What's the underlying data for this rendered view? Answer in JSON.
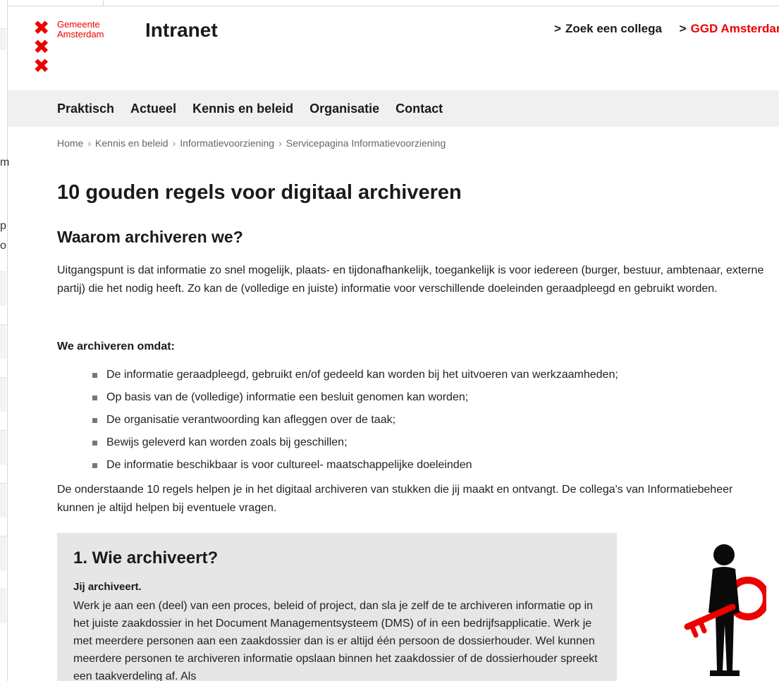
{
  "header": {
    "logo_line1": "Gemeente",
    "logo_line2": "Amsterdam",
    "site_title": "Intranet",
    "top_links": [
      {
        "label": "Zoek een collega"
      },
      {
        "label": "GGD Amsterdam"
      }
    ]
  },
  "nav": {
    "items": [
      {
        "label": "Praktisch"
      },
      {
        "label": "Actueel"
      },
      {
        "label": "Kennis en beleid"
      },
      {
        "label": "Organisatie"
      },
      {
        "label": "Contact"
      }
    ]
  },
  "breadcrumb": [
    "Home",
    "Kennis en beleid",
    "Informatievoorziening",
    "Servicepagina Informatievoorziening"
  ],
  "main": {
    "title": "10 gouden regels voor digitaal archiveren",
    "why_heading": "Waarom archiveren we?",
    "intro": "Uitgangspunt is dat informatie zo snel mogelijk, plaats- en tijdonafhankelijk, toegankelijk is voor iedereen (burger, bestuur, ambtenaar, externe partij) die het nodig heeft. Zo kan de (volledige en juiste) informatie voor verschillende doeleinden geraadpleegd en gebruikt worden.",
    "because_heading": "We archiveren omdat:",
    "reasons": [
      "De informatie geraadpleegd, gebruikt en/of gedeeld kan worden bij het uitvoeren van werkzaamheden;",
      "Op basis van de (volledige) informatie een besluit genomen kan worden;",
      "De organisatie verantwoording kan afleggen over de taak;",
      "Bewijs geleverd kan worden zoals bij geschillen;",
      "De informatie beschikbaar is voor cultureel- maatschappelijke doeleinden"
    ],
    "outro": "De onderstaande 10 regels helpen je in het digitaal archiveren van stukken die jij maakt en ontvangt. De collega's van Informatiebeheer kunnen je altijd helpen bij eventuele vragen."
  },
  "rule1": {
    "heading": "1. Wie archiveert?",
    "subheading": "Jij archiveert.",
    "body": "Werk je aan een (deel) van een proces, beleid of project, dan sla je zelf de te archiveren informatie op in het juiste zaakdossier in het Document Managementsysteem (DMS) of in een bedrijfsapplicatie. Werk je met meerdere personen aan een zaakdossier dan is er altijd één persoon de dossierhouder. Wel kunnen meerdere personen te archiveren informatie opslaan binnen het zaakdossier of de dossierhouder spreekt een taakverdeling af. Als"
  },
  "icons": {
    "logo": "andreas-cross-icon",
    "link_chevron": "chevron-right-icon",
    "illustration": "person-with-key-icon"
  },
  "colors": {
    "brand_red": "#ec0000",
    "nav_bg": "#f0f0f0",
    "box_bg": "#e6e6e6",
    "text": "#1a1a1a"
  }
}
